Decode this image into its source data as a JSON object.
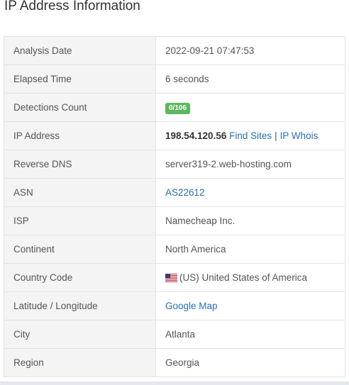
{
  "page": {
    "title": "IP Address Information"
  },
  "rows": {
    "analysis_date": {
      "label": "Analysis Date",
      "value": "2022-09-21 07:47:53"
    },
    "elapsed_time": {
      "label": "Elapsed Time",
      "value": "6 seconds"
    },
    "detections_count": {
      "label": "Detections Count",
      "badge": "0/106",
      "badge_color": "#5cb85c"
    },
    "ip_address": {
      "label": "IP Address",
      "ip": "198.54.120.56",
      "find_sites_link": "Find Sites",
      "separator": "|",
      "ip_whois_link": "IP Whois"
    },
    "reverse_dns": {
      "label": "Reverse DNS",
      "value": "server319-2.web-hosting.com"
    },
    "asn": {
      "label": "ASN",
      "link": "AS22612"
    },
    "isp": {
      "label": "ISP",
      "value": "Namecheap Inc."
    },
    "continent": {
      "label": "Continent",
      "value": "North America"
    },
    "country_code": {
      "label": "Country Code",
      "flag_icon": "us-flag-icon",
      "value": "(US) United States of America"
    },
    "lat_long": {
      "label": "Latitude / Longitude",
      "link": "Google Map"
    },
    "city": {
      "label": "City",
      "value": "Atlanta"
    },
    "region": {
      "label": "Region",
      "value": "Georgia"
    }
  },
  "colors": {
    "link": "#2a6fb0",
    "label_bg": "#f4f4f4",
    "border": "#e3e3e3"
  }
}
